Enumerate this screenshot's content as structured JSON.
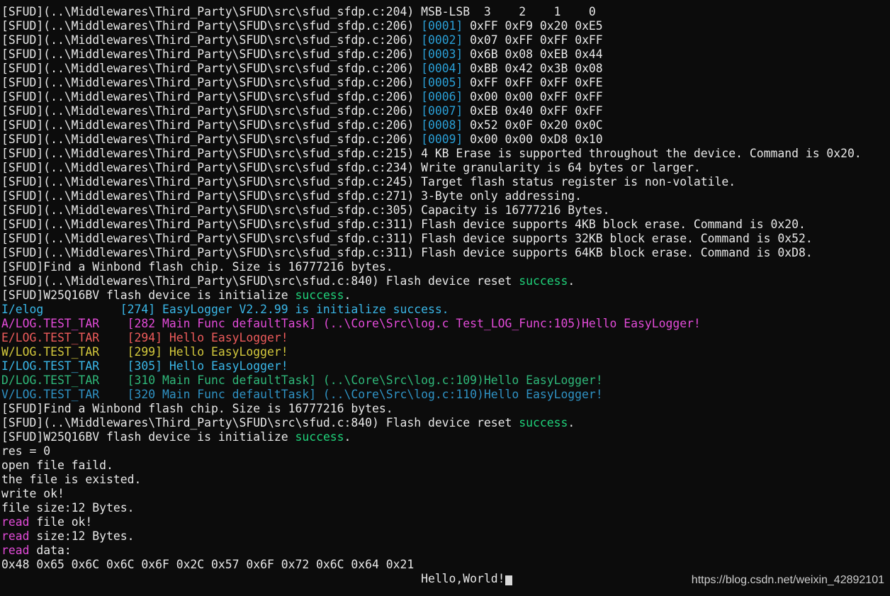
{
  "colors": {
    "background": "#0c0c0c",
    "default_text": "#e8e8e8",
    "blue": "#2a9fd6",
    "light_blue": "#3ab7e8",
    "green": "#1fd27a",
    "magenta": "#e34bd9",
    "red": "#ee5b5b",
    "yellow": "#d4c93c",
    "teal_green": "#2fb87a",
    "dark_cyan": "#2f92c4",
    "cursor": "#d9d9d9"
  },
  "terminal": {
    "lines": [
      [
        {
          "t": "[SFUD](..\\Middlewares\\Third_Party\\SFUD\\src\\sfud_sfdp.c:204) MSB-LSB  3    2    1    0"
        }
      ],
      [
        {
          "t": "[SFUD](..\\Middlewares\\Third_Party\\SFUD\\src\\sfud_sfdp.c:206) "
        },
        {
          "t": "[0001]",
          "c": "blue"
        },
        {
          "t": " 0xFF 0xF9 0x20 0xE5"
        }
      ],
      [
        {
          "t": "[SFUD](..\\Middlewares\\Third_Party\\SFUD\\src\\sfud_sfdp.c:206) "
        },
        {
          "t": "[0002]",
          "c": "blue"
        },
        {
          "t": " 0x07 0xFF 0xFF 0xFF"
        }
      ],
      [
        {
          "t": "[SFUD](..\\Middlewares\\Third_Party\\SFUD\\src\\sfud_sfdp.c:206) "
        },
        {
          "t": "[0003]",
          "c": "blue"
        },
        {
          "t": " 0x6B 0x08 0xEB 0x44"
        }
      ],
      [
        {
          "t": "[SFUD](..\\Middlewares\\Third_Party\\SFUD\\src\\sfud_sfdp.c:206) "
        },
        {
          "t": "[0004]",
          "c": "blue"
        },
        {
          "t": " 0xBB 0x42 0x3B 0x08"
        }
      ],
      [
        {
          "t": "[SFUD](..\\Middlewares\\Third_Party\\SFUD\\src\\sfud_sfdp.c:206) "
        },
        {
          "t": "[0005]",
          "c": "blue"
        },
        {
          "t": " 0xFF 0xFF 0xFF 0xFE"
        }
      ],
      [
        {
          "t": "[SFUD](..\\Middlewares\\Third_Party\\SFUD\\src\\sfud_sfdp.c:206) "
        },
        {
          "t": "[0006]",
          "c": "blue"
        },
        {
          "t": " 0x00 0x00 0xFF 0xFF"
        }
      ],
      [
        {
          "t": "[SFUD](..\\Middlewares\\Third_Party\\SFUD\\src\\sfud_sfdp.c:206) "
        },
        {
          "t": "[0007]",
          "c": "blue"
        },
        {
          "t": " 0xEB 0x40 0xFF 0xFF"
        }
      ],
      [
        {
          "t": "[SFUD](..\\Middlewares\\Third_Party\\SFUD\\src\\sfud_sfdp.c:206) "
        },
        {
          "t": "[0008]",
          "c": "blue"
        },
        {
          "t": " 0x52 0x0F 0x20 0x0C"
        }
      ],
      [
        {
          "t": "[SFUD](..\\Middlewares\\Third_Party\\SFUD\\src\\sfud_sfdp.c:206) "
        },
        {
          "t": "[0009]",
          "c": "blue"
        },
        {
          "t": " 0x00 0x00 0xD8 0x10"
        }
      ],
      [
        {
          "t": "[SFUD](..\\Middlewares\\Third_Party\\SFUD\\src\\sfud_sfdp.c:215) 4 KB Erase is supported throughout the device. Command is 0x20."
        }
      ],
      [
        {
          "t": "[SFUD](..\\Middlewares\\Third_Party\\SFUD\\src\\sfud_sfdp.c:234) Write granularity is 64 bytes or larger."
        }
      ],
      [
        {
          "t": "[SFUD](..\\Middlewares\\Third_Party\\SFUD\\src\\sfud_sfdp.c:245) Target flash status register is non-volatile."
        }
      ],
      [
        {
          "t": "[SFUD](..\\Middlewares\\Third_Party\\SFUD\\src\\sfud_sfdp.c:271) 3-Byte only addressing."
        }
      ],
      [
        {
          "t": "[SFUD](..\\Middlewares\\Third_Party\\SFUD\\src\\sfud_sfdp.c:305) Capacity is 16777216 Bytes."
        }
      ],
      [
        {
          "t": "[SFUD](..\\Middlewares\\Third_Party\\SFUD\\src\\sfud_sfdp.c:311) Flash device supports 4KB block erase. Command is 0x20."
        }
      ],
      [
        {
          "t": "[SFUD](..\\Middlewares\\Third_Party\\SFUD\\src\\sfud_sfdp.c:311) Flash device supports 32KB block erase. Command is 0x52."
        }
      ],
      [
        {
          "t": "[SFUD](..\\Middlewares\\Third_Party\\SFUD\\src\\sfud_sfdp.c:311) Flash device supports 64KB block erase. Command is 0xD8."
        }
      ],
      [
        {
          "t": "[SFUD]Find a Winbond flash chip. Size is 16777216 bytes."
        }
      ],
      [
        {
          "t": "[SFUD](..\\Middlewares\\Third_Party\\SFUD\\src\\sfud.c:840) Flash device reset "
        },
        {
          "t": "success",
          "c": "green"
        },
        {
          "t": "."
        }
      ],
      [
        {
          "t": "[SFUD]W25Q16BV flash device is initialize "
        },
        {
          "t": "success",
          "c": "green"
        },
        {
          "t": "."
        }
      ],
      [
        {
          "t": "I/elog           [274] EasyLogger V2.2.99 is initialize success.",
          "c": "light_blue"
        }
      ],
      [
        {
          "t": "A/LOG.TEST_TAR    [282 Main Func defaultTask] (..\\Core\\Src\\log.c Test_LOG_Func:105)Hello EasyLogger!",
          "c": "magenta"
        }
      ],
      [
        {
          "t": "E/LOG.TEST_TAR    [294] Hello EasyLogger!",
          "c": "red"
        }
      ],
      [
        {
          "t": "W/LOG.TEST_TAR    [299] Hello EasyLogger!",
          "c": "yellow"
        }
      ],
      [
        {
          "t": "I/LOG.TEST_TAR    [305] Hello EasyLogger!",
          "c": "light_blue"
        }
      ],
      [
        {
          "t": "D/LOG.TEST_TAR    [310 Main Func defaultTask] (..\\Core\\Src\\log.c:109)Hello EasyLogger!",
          "c": "teal_green"
        }
      ],
      [
        {
          "t": "V/LOG.TEST_TAR    [320 Main Func defaultTask] (..\\Core\\Src\\log.c:110)Hello EasyLogger!",
          "c": "dark_cyan"
        }
      ],
      [
        {
          "t": "[SFUD]Find a Winbond flash chip. Size is 16777216 bytes."
        }
      ],
      [
        {
          "t": "[SFUD](..\\Middlewares\\Third_Party\\SFUD\\src\\sfud.c:840) Flash device reset "
        },
        {
          "t": "success",
          "c": "green"
        },
        {
          "t": "."
        }
      ],
      [
        {
          "t": "[SFUD]W25Q16BV flash device is initialize "
        },
        {
          "t": "success",
          "c": "green"
        },
        {
          "t": "."
        }
      ],
      [
        {
          "t": "res = 0"
        }
      ],
      [
        {
          "t": "open file faild."
        }
      ],
      [
        {
          "t": "the file is existed."
        }
      ],
      [
        {
          "t": "write ok!"
        }
      ],
      [
        {
          "t": "file size:12 Bytes."
        }
      ],
      [
        {
          "t": "read",
          "c": "magenta"
        },
        {
          "t": " file ok!"
        }
      ],
      [
        {
          "t": "read",
          "c": "magenta"
        },
        {
          "t": " size:12 Bytes."
        }
      ],
      [
        {
          "t": "read",
          "c": "magenta"
        },
        {
          "t": " data:"
        }
      ],
      [
        {
          "t": "0x48 0x65 0x6C 0x6C 0x6F 0x2C 0x57 0x6F 0x72 0x6C 0x64 0x21"
        }
      ],
      [
        {
          "t": "                                                            Hello,World!"
        }
      ]
    ]
  },
  "watermark": {
    "text": "https://blog.csdn.net/weixin_42892101"
  }
}
